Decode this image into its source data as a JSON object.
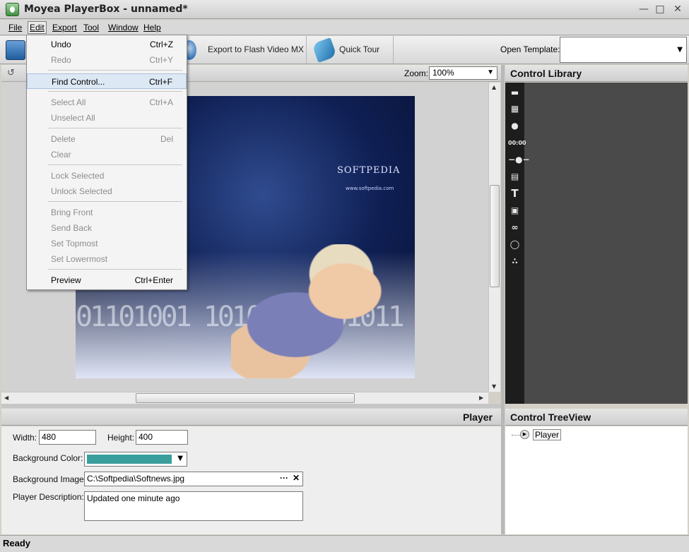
{
  "window": {
    "title": "Moyea PlayerBox - unnamed*"
  },
  "menubar": [
    "File",
    "Edit",
    "Export",
    "Tool",
    "Window",
    "Help"
  ],
  "toolbar": {
    "export_label": "Export to Flash Video MX",
    "tour_label": "Quick Tour",
    "template_label": "Open Template:",
    "template_value": ""
  },
  "canvas": {
    "zoom_label": "Zoom:",
    "zoom_value": "100%",
    "stage_text": "SOFTPEDIA",
    "stage_url": "www.softpedia.com"
  },
  "library": {
    "title": "Control Library"
  },
  "properties": {
    "title": "Player",
    "width_label": "Width:",
    "width_value": "480",
    "height_label": "Height:",
    "height_value": "400",
    "bg_color_label": "Background Color:",
    "bg_color_value": "#3a9e9c",
    "bg_image_label": "Background Image:",
    "bg_image_value": "C:\\Softpedia\\Softnews.jpg",
    "browse_symbol": "···",
    "clear_symbol": "✕",
    "description_label": "Player Description:",
    "description_value": "Updated one minute ago"
  },
  "treeview": {
    "title": "Control TreeView",
    "root_node": "Player"
  },
  "status": {
    "text": "Ready"
  },
  "edit_menu": [
    {
      "label": "Undo",
      "shortcut": "Ctrl+Z",
      "enabled": true
    },
    {
      "label": "Redo",
      "shortcut": "Ctrl+Y",
      "enabled": false
    },
    {
      "label": "Find Control...",
      "shortcut": "Ctrl+F",
      "enabled": true
    },
    {
      "label": "Select All",
      "shortcut": "Ctrl+A",
      "enabled": false
    },
    {
      "label": "Unselect All",
      "shortcut": "",
      "enabled": false
    },
    {
      "label": "Delete",
      "shortcut": "Del",
      "enabled": false
    },
    {
      "label": "Clear",
      "shortcut": "",
      "enabled": false
    },
    {
      "label": "Lock Selected",
      "shortcut": "",
      "enabled": false
    },
    {
      "label": "Unlock Selected",
      "shortcut": "",
      "enabled": false
    },
    {
      "label": "Bring Front",
      "shortcut": "",
      "enabled": false
    },
    {
      "label": "Send Back",
      "shortcut": "",
      "enabled": false
    },
    {
      "label": "Set Topmost",
      "shortcut": "",
      "enabled": false
    },
    {
      "label": "Set Lowermost",
      "shortcut": "",
      "enabled": false
    },
    {
      "label": "Preview",
      "shortcut": "Ctrl+Enter",
      "enabled": true
    }
  ]
}
